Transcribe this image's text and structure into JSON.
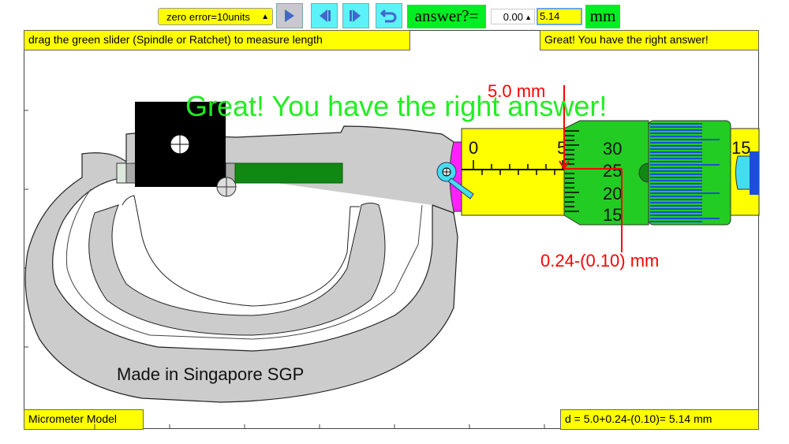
{
  "toolbar": {
    "zero_error_select": "zero error=10units",
    "play_icon": "play-icon",
    "step_back_icon": "step-back-icon",
    "step_forward_icon": "step-forward-icon",
    "reset_icon": "reset-icon",
    "answer_label": "answer?=",
    "answer_spinner": "0.00",
    "answer_input": "5.14",
    "unit": "mm"
  },
  "panels": {
    "instruction": "drag the green slider (Spindle or Ratchet) to measure length",
    "feedback": "Great! You have the right answer!",
    "big_message": "Great! You have the right answer!",
    "model_label": "Micrometer Model",
    "formula": "d = 5.0+0.24-(0.10)= 5.14 mm",
    "made_in": "Made in Singapore SGP"
  },
  "micrometer": {
    "main_scale_labels": [
      "0",
      "5",
      "15"
    ],
    "thimble_labels": [
      "30",
      "25",
      "20",
      "15"
    ],
    "main_reading": "5.0 mm",
    "thimble_reading": "0.24-(0.10) mm",
    "colors": {
      "frame": "#cccccc",
      "sleeve": "#ffff00",
      "thimble": "#22cc22",
      "ratchet_lines": "#1a4fd6",
      "spindle": "#118811",
      "anvil_block": "#000000",
      "annotation": "#ff0000",
      "lock": "#44ddee",
      "magenta": "#ff22ff"
    }
  }
}
